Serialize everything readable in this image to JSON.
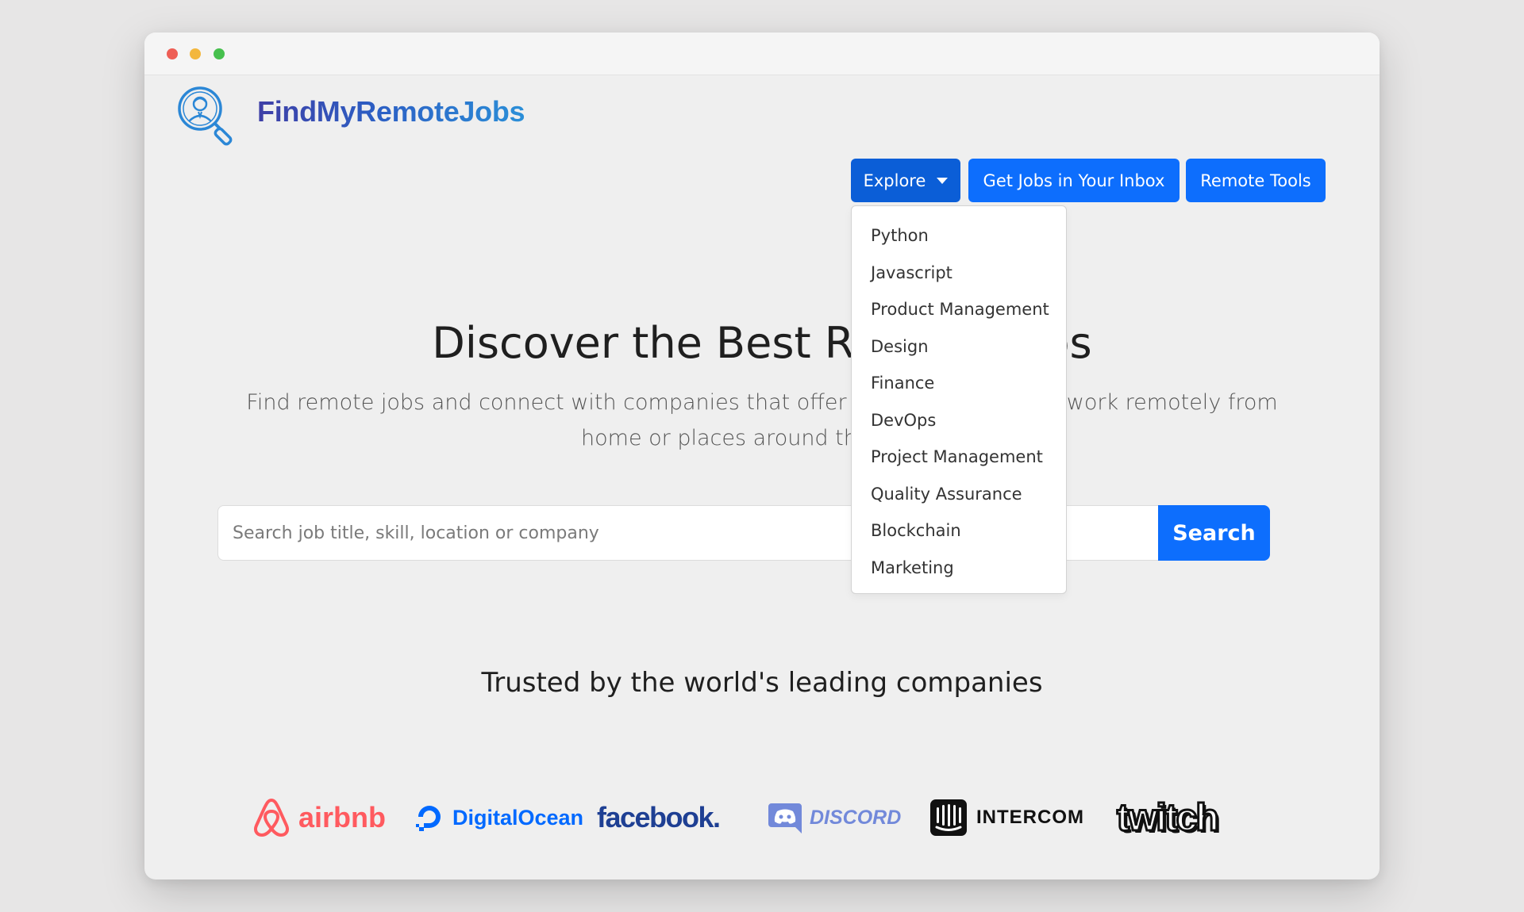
{
  "brand": {
    "name": "FindMyRemoteJobs"
  },
  "nav": {
    "explore_label": "Explore",
    "inbox_label": "Get Jobs in Your Inbox",
    "tools_label": "Remote Tools"
  },
  "dropdown": {
    "items": [
      "Python",
      "Javascript",
      "Product Management",
      "Design",
      "Finance",
      "DevOps",
      "Project Management",
      "Quality Assurance",
      "Blockchain",
      "Marketing"
    ]
  },
  "hero": {
    "title": "Discover the Best Remote Jobs",
    "subtitle": "Find remote jobs and connect with companies that offer you the freedom to work remotely from home or places around the world."
  },
  "search": {
    "placeholder": "Search job title, skill, location or company",
    "button_label": "Search"
  },
  "trusted": {
    "heading": "Trusted by the world's leading companies",
    "logos": [
      {
        "name": "airbnb",
        "icon": "airbnb-icon",
        "color": "#ff5a5f"
      },
      {
        "name": "DigitalOcean",
        "icon": "digitalocean-icon",
        "color": "#0069ff"
      },
      {
        "name": "facebook.",
        "icon": "facebook-icon",
        "color": "#1e3f93"
      },
      {
        "name": "DISCORD",
        "icon": "discord-icon",
        "color": "#7289da"
      },
      {
        "name": "INTERCOM",
        "icon": "intercom-icon",
        "color": "#111111"
      },
      {
        "name": "twitch",
        "icon": "twitch-icon",
        "color": "#111111"
      }
    ]
  },
  "colors": {
    "primary": "#0d6efd",
    "primary_active": "#0b5ed7",
    "page_bg": "#efefef"
  }
}
